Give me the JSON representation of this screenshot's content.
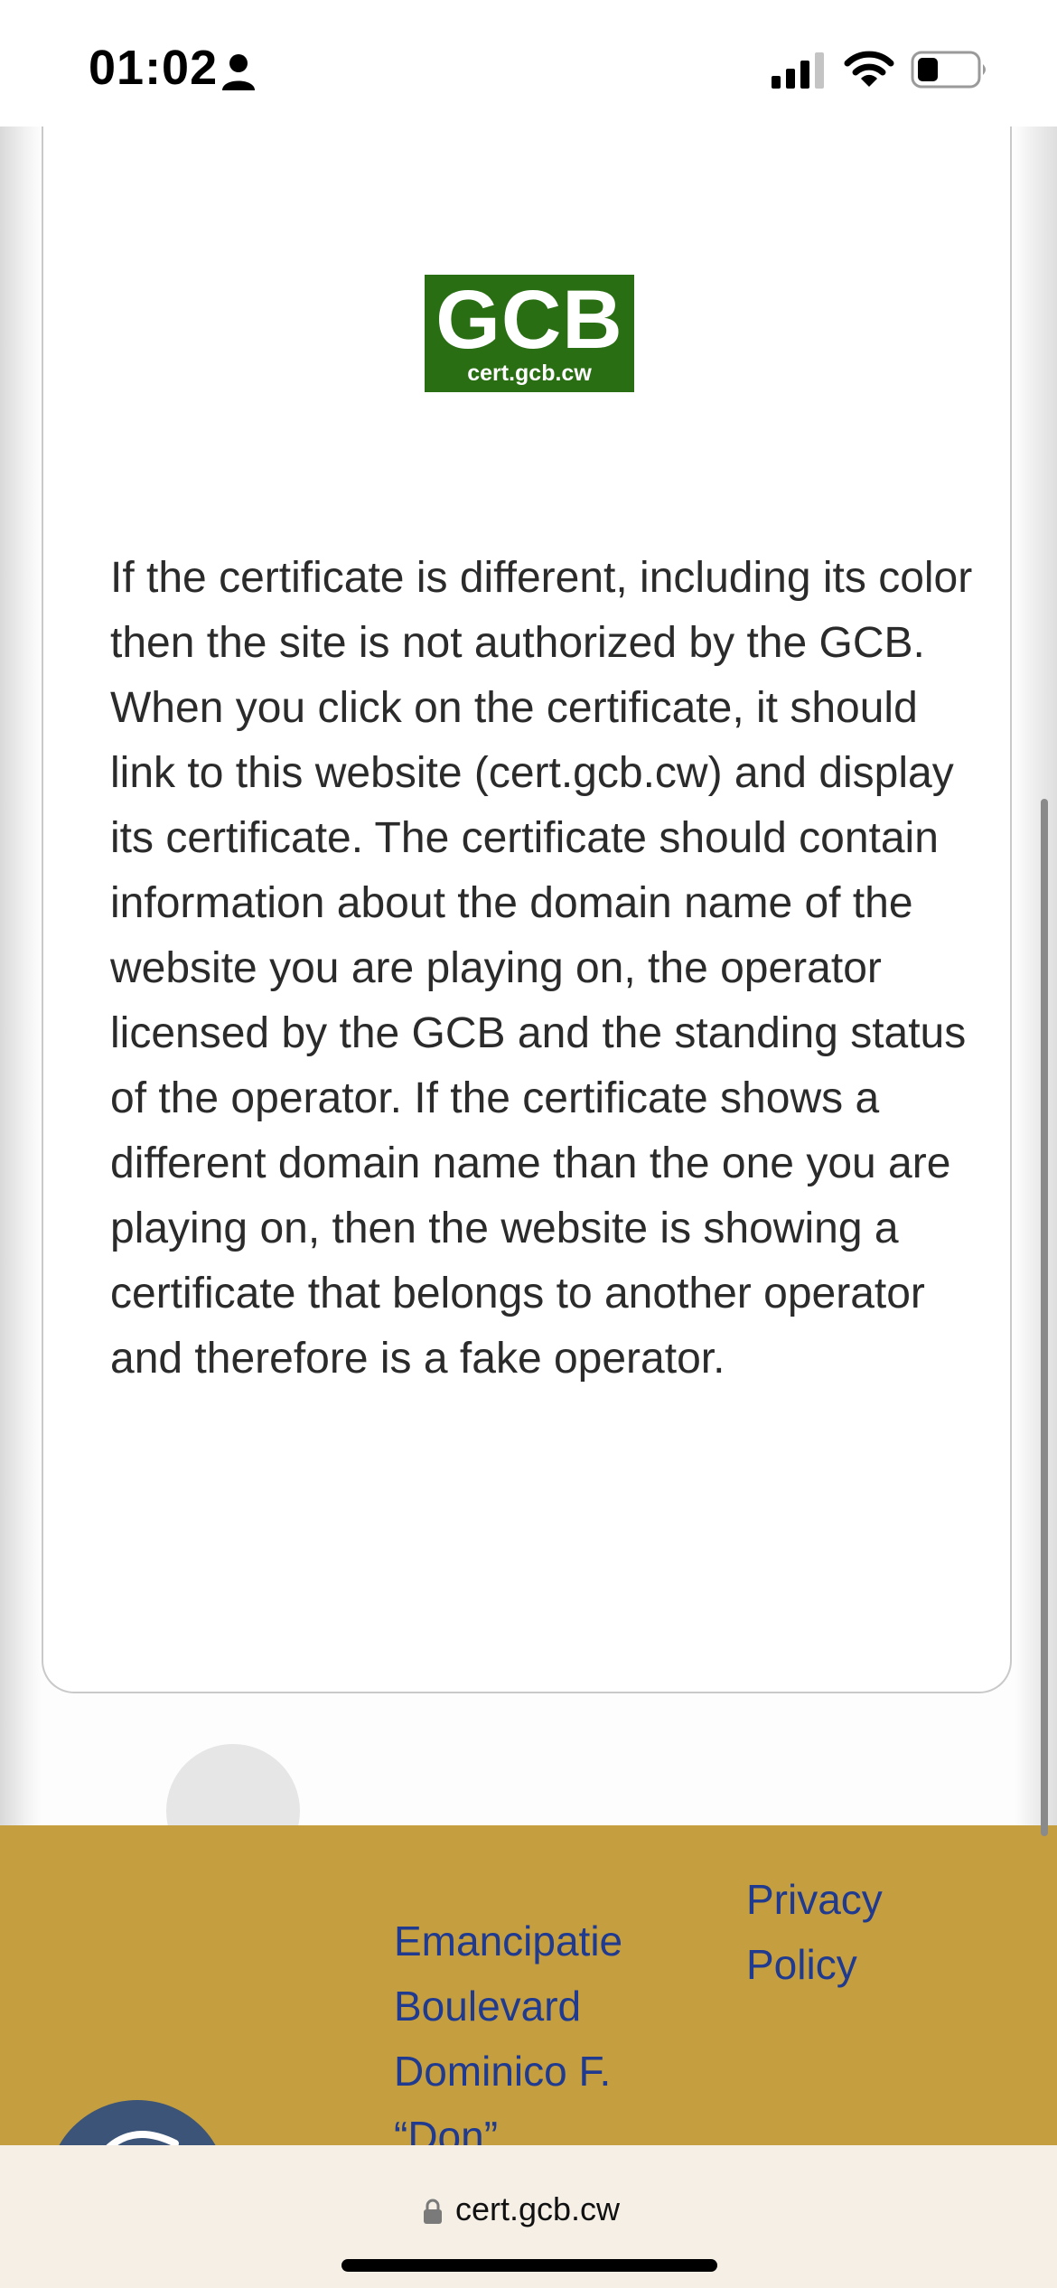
{
  "status_bar": {
    "time": "01:02",
    "icons": [
      "person-icon",
      "signal-icon",
      "wifi-icon",
      "battery-icon"
    ]
  },
  "modal": {
    "badge": {
      "title": "GCB",
      "subtitle": "cert.gcb.cw",
      "color": "#2a6e14"
    },
    "body_text": "If the certificate is different, including its color then the site is not authorized by the GCB. When you click on the certificate, it should link to this website (cert.gcb.cw) and display its certificate. The certificate should contain information about the domain name of the website you are playing on, the operator licensed by the GCB and the standing status of the operator. If the certificate shows a different domain name than the one you are playing on, then the website is showing a certificate that belongs to another operator and therefore is a fake operator."
  },
  "footer": {
    "background": "#c49e3f",
    "link_color": "#1f3a8f",
    "address_lines": [
      "Emancipatie",
      "Boulevard",
      "Dominico F.",
      "“Don”"
    ],
    "privacy_label": "Privacy Policy"
  },
  "browser": {
    "url": "cert.gcb.cw"
  }
}
